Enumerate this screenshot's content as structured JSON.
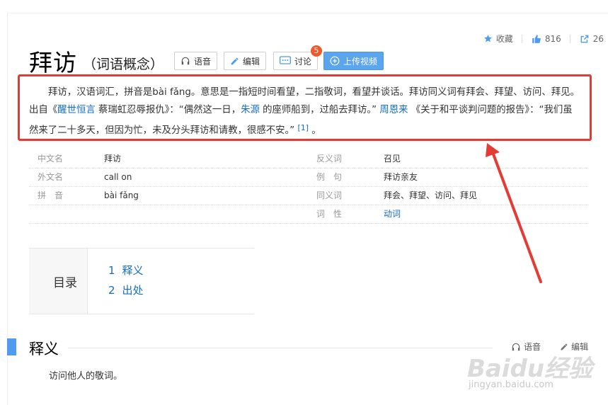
{
  "header": {
    "title": "拜访",
    "subtitle": "（词语概念）",
    "buttons": {
      "voice": "语音",
      "edit": "编辑",
      "discuss": "讨论",
      "discuss_badge": "5",
      "upload": "上传视频"
    },
    "stats": {
      "collect": "收藏",
      "likes": "816",
      "shares": "26"
    }
  },
  "summary": {
    "part1": "拜访，汉语词汇，拼音是bài fǎng。意思是一指短时间看望，二指敬词，看望并谈话。拜访同义词有拜会、拜望、访问、拜见。出自《",
    "link1": "醒世恒言",
    "part2": " 蔡瑞虹忍辱报仇》：“偶然这一日，",
    "link2": "朱源",
    "part3": " 的座师船到，过船去拜访。” ",
    "link3": "周恩来",
    "part4": " 《关于和平谈判问题的报告》：“我们虽然来了二十多天，但因为忙，未及分头拜访和请教，很感不安。” ",
    "ref": "[1]",
    "end": "。"
  },
  "info": {
    "left": [
      {
        "label": "中文名",
        "value": "拜访"
      },
      {
        "label": "外文名",
        "value": "call on"
      },
      {
        "label": "拼　音",
        "value": "bài fǎng"
      }
    ],
    "right": [
      {
        "label": "反义词",
        "value": "召见"
      },
      {
        "label": "例　句",
        "value": "拜访亲友"
      },
      {
        "label": "同义词",
        "value": "拜会、拜望、访问、拜见"
      },
      {
        "label": "词　性",
        "value": "动词"
      }
    ]
  },
  "catalog": {
    "title": "目录",
    "items": [
      {
        "num": "1",
        "label": "释义"
      },
      {
        "num": "2",
        "label": "出处"
      }
    ]
  },
  "section": {
    "title": "释义",
    "voice": "语音",
    "edit": "编辑",
    "body": "访问他人的敬词。"
  },
  "watermark": {
    "brand": "Baidu经验",
    "url": "jingyan.baidu.com"
  },
  "colors": {
    "accent": "#136ec2",
    "highlight": "#e53b35",
    "upload_button": "#5aa5ec",
    "badge": "#f05a2a"
  }
}
